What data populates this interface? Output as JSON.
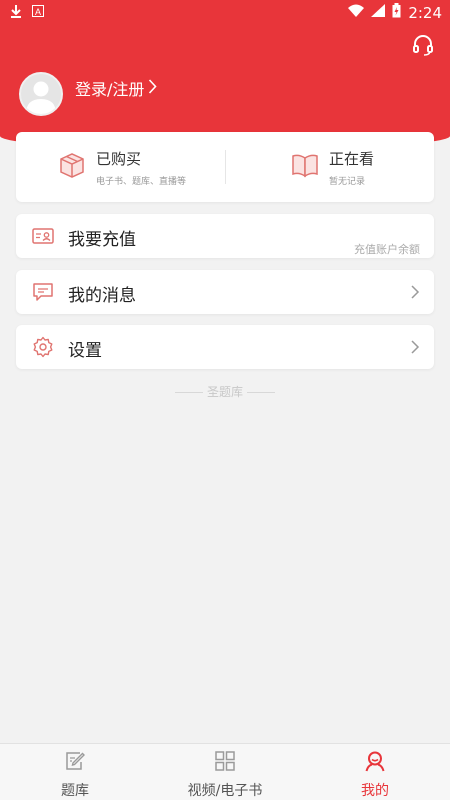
{
  "status_bar": {
    "time": "2:24"
  },
  "colors": {
    "brand": "#e8353a",
    "background": "#f2f2f2"
  },
  "header": {
    "login_label": "登录/注册"
  },
  "top_card": {
    "purchased": {
      "title": "已购买",
      "subtitle": "电子书、题库、直播等"
    },
    "watching": {
      "title": "正在看",
      "subtitle": "暂无记录"
    }
  },
  "menu": {
    "recharge": {
      "label": "我要充值",
      "hint": "充值账户余额"
    },
    "messages": {
      "label": "我的消息"
    },
    "settings": {
      "label": "设置"
    }
  },
  "brand_text": "圣题库",
  "tabs": [
    {
      "label": "题库",
      "icon": "edit-icon",
      "active": false
    },
    {
      "label": "视频/电子书",
      "icon": "grid-icon",
      "active": false
    },
    {
      "label": "我的",
      "icon": "user-icon",
      "active": true
    }
  ]
}
